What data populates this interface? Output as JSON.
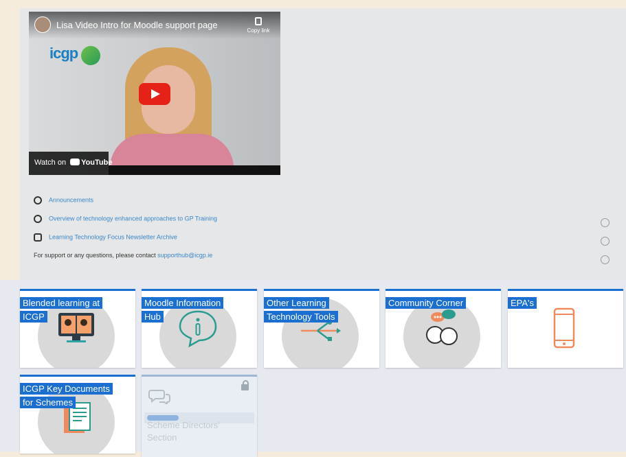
{
  "video": {
    "title": "Lisa Video Intro for Moodle support page",
    "copy_link": "Copy link",
    "watch_on": "Watch on",
    "youtube": "YouTube",
    "logo_text": "icgp"
  },
  "links": [
    {
      "label": "Announcements",
      "icon": "megaphone-icon"
    },
    {
      "label": "Overview of technology enhanced approaches to GP Training",
      "icon": "page-icon"
    },
    {
      "label": "Learning Technology Focus Newsletter Archive",
      "icon": "book-icon"
    }
  ],
  "support": {
    "text": "For support or any questions, please contact",
    "email": "supporthub@icgp.ie"
  },
  "tiles": [
    {
      "label": "Blended learning at ICGP",
      "icon": "video-call-icon"
    },
    {
      "label": "Moodle Information Hub",
      "icon": "info-chat-icon"
    },
    {
      "label": "Other Learning Technology Tools",
      "icon": "usb-icon"
    },
    {
      "label": "Community Corner",
      "icon": "conversation-icon"
    },
    {
      "label": "EPA's",
      "icon": "phone-icon"
    },
    {
      "label": "ICGP Key Documents for Schemes",
      "icon": "documents-icon"
    }
  ],
  "restricted_tile": {
    "label": "Scheme Directors' Section",
    "icon": "chat-icon",
    "status": "lock-icon"
  },
  "colors": {
    "page_bg": "#f5ecdd",
    "panel_bg": "#e6e7e8",
    "tile_accent": "#1b6fd1",
    "link": "#3a86c8"
  }
}
